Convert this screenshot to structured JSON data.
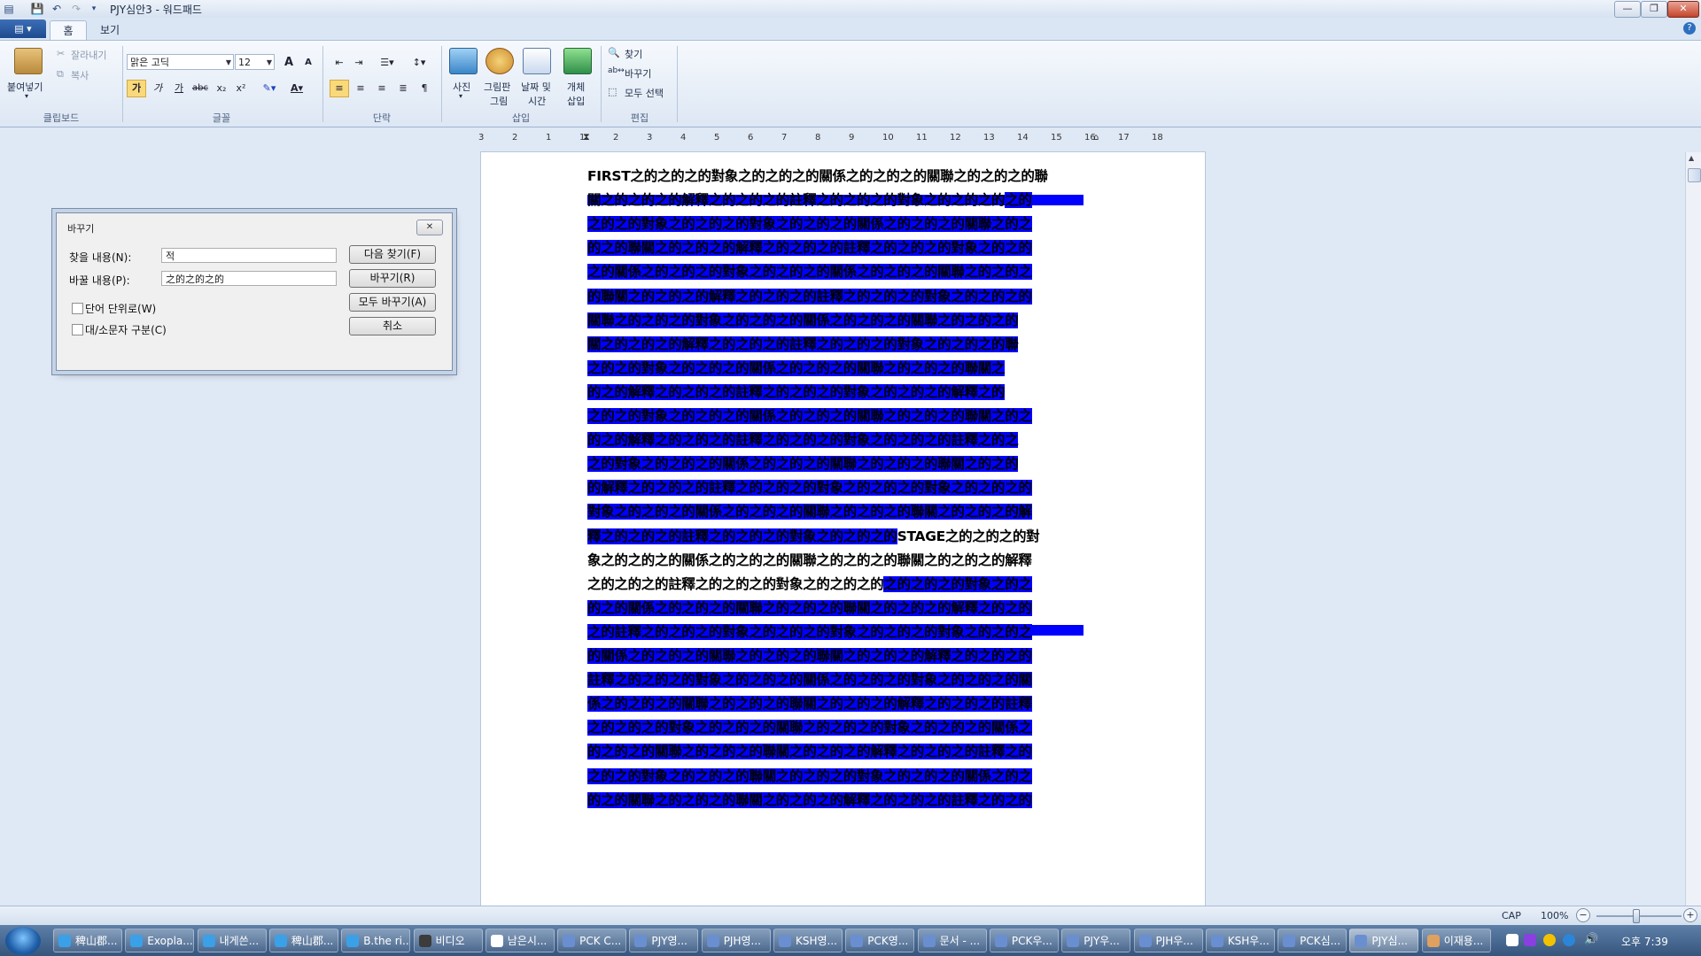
{
  "window": {
    "title": "PJY심안3 - 워드패드",
    "minimize": "—",
    "maximize": "❐",
    "close": "✕"
  },
  "tabs": {
    "app_menu": "▤ ▾",
    "home": "홈",
    "view": "보기"
  },
  "ribbon": {
    "clipboard": {
      "paste": "붙여넣기",
      "cut": "잘라내기",
      "copy": "복사",
      "label": "클립보드"
    },
    "font": {
      "name": "맑은 고딕",
      "size": "12",
      "grow": "A",
      "shrink": "A",
      "bold": "가",
      "italic": "가",
      "underline": "가",
      "strike": "abc",
      "subscript": "x₂",
      "superscript": "x²",
      "label": "글꼴"
    },
    "paragraph": {
      "label": "단락"
    },
    "insert": {
      "picture": "사진",
      "paint_line1": "그림판",
      "paint_line2": "그림",
      "datetime_line1": "날짜 및",
      "datetime_line2": "시간",
      "object_line1": "개체",
      "object_line2": "삽입",
      "label": "삽입"
    },
    "editing": {
      "find": "찾기",
      "replace": "바꾸기",
      "select_all": "모두 선택",
      "label": "편집"
    }
  },
  "ruler": [
    "3",
    "2",
    "1",
    "1",
    "2",
    "3",
    "4",
    "5",
    "6",
    "7",
    "8",
    "9",
    "10",
    "11",
    "12",
    "13",
    "14",
    "15",
    "16",
    "17",
    "18"
  ],
  "document": {
    "lines": [
      {
        "pre": "FIRST之的之的之的對象之的之的之的關係之的之的之的關聯之的之的之的聯",
        "sel": ""
      },
      {
        "pre": "關之的之的之的解釋之的之的之的註釋之的之的之的對象之的之的之的",
        "sel": "之的"
      },
      {
        "pre": "",
        "sel": "之的之的對象之的之的之的對象之的之的之的關係之的之的之的關聯之的之"
      },
      {
        "pre": "",
        "sel": "的之的聯關之的之的之的解釋之的之的之的註釋之的之的之的對象之的之的"
      },
      {
        "pre": "",
        "sel": "之的關係之的之的之的對象之的之的之的關係之的之的之的關聯之的之的之"
      },
      {
        "pre": "",
        "sel": "的聯關之的之的之的解釋之的之的之的註釋之的之的之的對象之的之的之的"
      },
      {
        "pre": "",
        "sel": "關聯之的之的之的對象之的之的之的關係之的之的之的關聯之的之的之的"
      },
      {
        "pre": "",
        "sel": "關之的之的之的解釋之的之的之的註釋之的之的之的對象之的之的之的聯"
      },
      {
        "pre": "",
        "sel": "之的之的對象之的之的之的關係之的之的之的關聯之的之的之的聯關之"
      },
      {
        "pre": "",
        "sel": "的之的解釋之的之的之的註釋之的之的之的對象之的之的之的解釋之的"
      },
      {
        "pre": "",
        "sel": "之的之的對象之的之的之的關係之的之的之的關聯之的之的之的聯關之的之"
      },
      {
        "pre": "",
        "sel": "的之的解釋之的之的之的註釋之的之的之的對象之的之的之的註釋之的之"
      },
      {
        "pre": "",
        "sel": "之的對象之的之的之的關係之的之的之的關聯之的之的之的聯關之的之的"
      },
      {
        "pre": "",
        "sel": "的解釋之的之的之的註釋之的之的之的對象之的之的之的對象之的之的之的"
      },
      {
        "pre": "",
        "sel": "對象之的之的之的關係之的之的之的關聯之的之的之的聯關之的之的之的解"
      },
      {
        "pre": "",
        "sel": "釋之的之的之的註釋之的之的之的對象之的之的之的",
        "post": "STAGE之的之的之的對"
      },
      {
        "pre": "象之的之的之的關係之的之的之的關聯之的之的之的聯關之的之的之的解釋",
        "sel": ""
      },
      {
        "pre": "之的之的之的註釋之的之的之的對象之的之的之的",
        "sel": "之的之的之的對象之的之"
      },
      {
        "pre": "",
        "sel": "的之的關係之的之的之的關聯之的之的之的聯關之的之的之的解釋之的之的"
      },
      {
        "pre": "",
        "sel": "之的註釋之的之的之的對象之的之的之的對象之的之的之的對象之的之的之"
      },
      {
        "pre": "",
        "sel": "的關係之的之的之的關聯之的之的之的聯關之的之的之的解釋之的之的之的"
      },
      {
        "pre": "",
        "sel": "註釋之的之的之的對象之的之的之的關係之的之的之的對象之的之的之的關"
      },
      {
        "pre": "",
        "sel": "係之的之的之的關聯之的之的之的聯關之的之的之的解釋之的之的之的註釋"
      },
      {
        "pre": "",
        "sel": "之的之的之的對象之的之的之的關聯之的之的之的對象之的之的之的關係之"
      },
      {
        "pre": "",
        "sel": "的之的之的關聯之的之的之的聯關之的之的之的解釋之的之的之的註釋之的"
      },
      {
        "pre": "",
        "sel": "之的之的對象之的之的之的聯關之的之的之的對象之的之的之的關係之的之"
      },
      {
        "pre": "",
        "sel": "的之的關聯之的之的之的聯關之的之的之的解釋之的之的之的註釋之的之的"
      }
    ]
  },
  "dialog": {
    "title": "바꾸기",
    "close": "✕",
    "find_label": "찾을 내용(N):",
    "find_value": "적",
    "replace_label": "바꿀 내용(P):",
    "replace_value": "之的之的之的",
    "whole_word": "단어 단위로(W)",
    "match_case": "대/소문자 구분(C)",
    "find_next": "다음 찾기(F)",
    "replace": "바꾸기(R)",
    "replace_all": "모두 바꾸기(A)",
    "cancel": "취소"
  },
  "statusbar": {
    "cap": "CAP",
    "zoom": "100%",
    "zoom_out": "−",
    "zoom_in": "+"
  },
  "taskbar": {
    "items": [
      "稗山郡...",
      "Exopla...",
      "내게쓴...",
      "稗山郡...",
      "B.the ri...",
      "비디오",
      "남은시...",
      "PCK C...",
      "PJY영...",
      "PJH영...",
      "KSH영...",
      "PCK영...",
      "문서 - ...",
      "PCK우...",
      "PJY우...",
      "PJH우...",
      "KSH우...",
      "PCK심...",
      "PJY심...",
      "이재용..."
    ],
    "clock": "오후 7:39"
  }
}
